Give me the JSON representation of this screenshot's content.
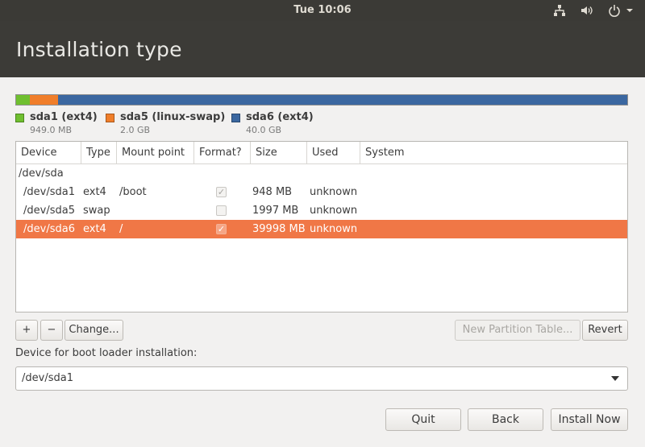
{
  "top_panel": {
    "clock": "Tue 10:06",
    "icons": [
      "network-icon",
      "volume-icon",
      "power-icon",
      "chevron-down-icon"
    ]
  },
  "header": {
    "title": "Installation type"
  },
  "partition_bar": {
    "segments": [
      {
        "name": "sda1 (ext4)",
        "size": "949.0 MB",
        "color": "#6fbf2f",
        "fraction": 0.022
      },
      {
        "name": "sda5 (linux-swap)",
        "size": "2.0 GB",
        "color": "#f07e2a",
        "fraction": 0.046
      },
      {
        "name": "sda6 (ext4)",
        "size": "40.0 GB",
        "color": "#3b67a0",
        "fraction": 0.932
      }
    ]
  },
  "table": {
    "headers": [
      "Device",
      "Type",
      "Mount point",
      "Format?",
      "Size",
      "Used",
      "System"
    ],
    "group": "/dev/sda",
    "rows": [
      {
        "device": "/dev/sda1",
        "type": "ext4",
        "mount": "/boot",
        "format": true,
        "size": "948 MB",
        "used": "unknown",
        "system": "",
        "selected": false
      },
      {
        "device": "/dev/sda5",
        "type": "swap",
        "mount": "",
        "format": false,
        "size": "1997 MB",
        "used": "unknown",
        "system": "",
        "selected": false
      },
      {
        "device": "/dev/sda6",
        "type": "ext4",
        "mount": "/",
        "format": true,
        "size": "39998 MB",
        "used": "unknown",
        "system": "",
        "selected": true
      }
    ]
  },
  "table_buttons": {
    "add": "+",
    "remove": "−",
    "change": "Change...",
    "new_table": "New Partition Table...",
    "revert": "Revert"
  },
  "boot_loader": {
    "label": "Device for boot loader installation:",
    "value": "/dev/sda1"
  },
  "footer": {
    "quit": "Quit",
    "back": "Back",
    "install": "Install Now"
  },
  "colors": {
    "selection": "#f07746",
    "panel": "#3b3a36",
    "header": "#3c3b37"
  }
}
